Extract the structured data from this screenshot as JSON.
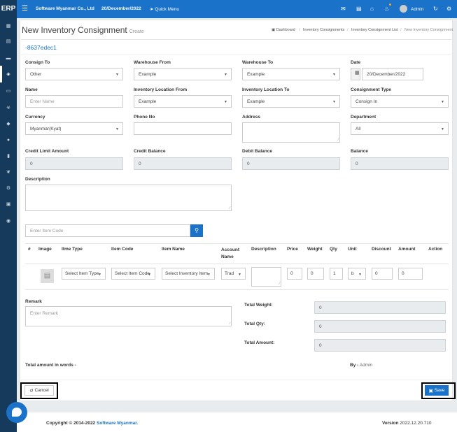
{
  "header": {
    "brand": "ERP",
    "company": "Software Myanmar Co., Ltd",
    "date": "20/December/2022",
    "quick_menu": "Quick Menu",
    "user": "Admin"
  },
  "page": {
    "title": "New Inventory Consignment",
    "subtitle": "Create",
    "code": "-8637edec1",
    "breadcrumb": [
      "Dashboard",
      "Inventory Consignments",
      "Inventory Consignment List",
      "New Inventory Consignment"
    ]
  },
  "form": {
    "consign_to": {
      "label": "Consign To",
      "value": "Other"
    },
    "warehouse_from": {
      "label": "Warehouse From",
      "value": "Example"
    },
    "warehouse_to": {
      "label": "Warehouse To",
      "value": "Example"
    },
    "date": {
      "label": "Date",
      "value": "20/December/2022"
    },
    "name": {
      "label": "Name",
      "placeholder": "Enter Name"
    },
    "inv_loc_from": {
      "label": "Inventory Location From",
      "value": "Example"
    },
    "inv_loc_to": {
      "label": "Inventory Location To",
      "value": "Example"
    },
    "consignment_type": {
      "label": "Consignment Type",
      "value": "Consign In"
    },
    "currency": {
      "label": "Currency",
      "value": "Myanmar(Kyat)"
    },
    "phone": {
      "label": "Phone No"
    },
    "address": {
      "label": "Address"
    },
    "department": {
      "label": "Department",
      "value": "All"
    },
    "credit_limit": {
      "label": "Credit Limit Amount",
      "value": "0"
    },
    "credit_balance": {
      "label": "Credit Balance",
      "value": "0"
    },
    "debit_balance": {
      "label": "Debit Balance",
      "value": "0"
    },
    "balance": {
      "label": "Balance",
      "value": "0"
    },
    "description": {
      "label": "Description"
    }
  },
  "search": {
    "placeholder": "Enter Item Code"
  },
  "table": {
    "headers": [
      "#",
      "Image",
      "Itme Type",
      "Item Code",
      "Item Name",
      "Account Name",
      "Description",
      "Price",
      "Weight",
      "Qty",
      "Unit",
      "Discount",
      "Amount",
      "Action"
    ],
    "row": {
      "item_type": "Select Item Type",
      "item_code": "Select Item Code",
      "item_name": "Select Inventory Item",
      "account": "Trad",
      "price": "0",
      "weight": "0",
      "qty": "1",
      "unit": "b",
      "discount": "0",
      "amount": "0"
    }
  },
  "remark": {
    "label": "Remark",
    "placeholder": "Enter Remark"
  },
  "totals": {
    "weight_label": "Total Weight:",
    "weight": "0",
    "qty_label": "Total Qty:",
    "qty": "0",
    "amount_label": "Total Amount:",
    "amount": "0"
  },
  "words_label": "Total amount in words -",
  "by": {
    "label": "By -",
    "name": "Admin"
  },
  "buttons": {
    "cancel": "Cancel",
    "save": "Save"
  },
  "footer": {
    "copyright": "Copyright © 2014-2022",
    "company": "Software Myanmar.",
    "version_label": "Version",
    "version": "2022.12.20.710"
  }
}
